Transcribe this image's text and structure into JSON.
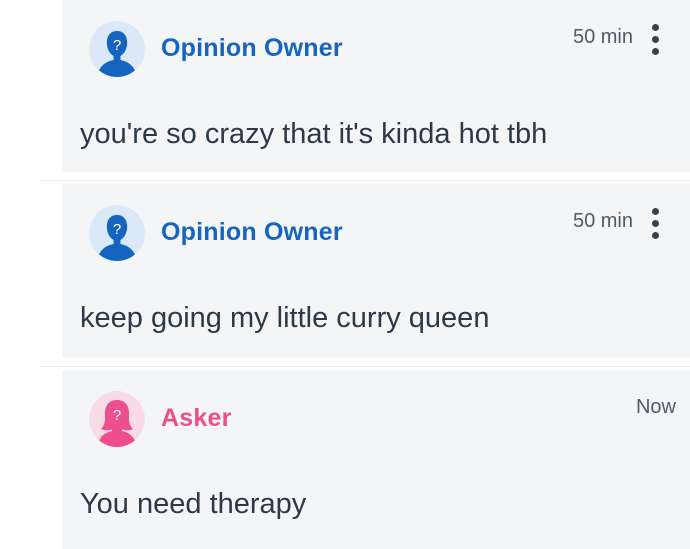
{
  "comments": [
    {
      "author": "Opinion Owner",
      "avatar": "anonymous-male-avatar",
      "author_color": "#1565c0",
      "time": "50 min",
      "text": "you're so crazy that it's kinda hot tbh",
      "menu_icon": "more-vertical-icon"
    },
    {
      "author": "Opinion Owner",
      "avatar": "anonymous-male-avatar",
      "author_color": "#1565c0",
      "time": "50 min",
      "text": "keep going my little curry queen",
      "menu_icon": "more-vertical-icon"
    },
    {
      "author": "Asker",
      "avatar": "anonymous-female-avatar",
      "author_color": "#ec4f8c",
      "time": "Now",
      "text": "You need therapy"
    }
  ]
}
